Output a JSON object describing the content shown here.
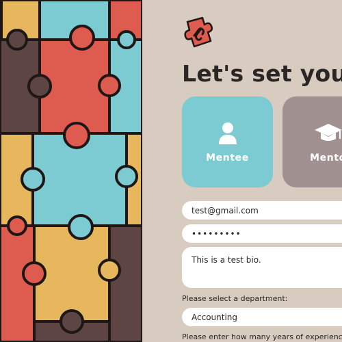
{
  "header": {
    "title": "Let's set you"
  },
  "logo": {
    "icon": "puzzle-link-icon",
    "color": "#dd5b4f"
  },
  "roles": [
    {
      "label": "Mentee",
      "icon": "user-icon",
      "color": "#7ccbd2"
    },
    {
      "label": "Mento",
      "icon": "graduation-cap-icon",
      "color": "#a09090"
    }
  ],
  "form": {
    "email_value": "test@gmail.com",
    "password_value": "•••••••••",
    "bio_value": "This is a test bio.",
    "department_label": "Please select a department:",
    "department_value": "Accounting",
    "years_label": "Please enter how many years of experience"
  },
  "colors": {
    "background": "#d7ccbf",
    "puzzle_red": "#dd5b4f",
    "puzzle_teal": "#7ccbd2",
    "puzzle_yellow": "#e6b75c",
    "puzzle_brown": "#5c4542",
    "outline": "#1e1716"
  }
}
